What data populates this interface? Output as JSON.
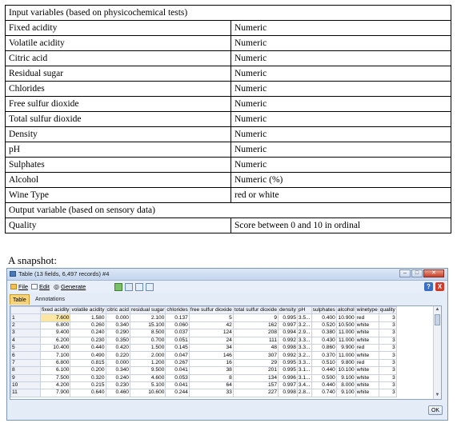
{
  "variables": {
    "input_header": "Input variables (based on physicochemical tests)",
    "inputs": [
      {
        "name": "Fixed acidity",
        "type": "Numeric"
      },
      {
        "name": "Volatile acidity",
        "type": "Numeric"
      },
      {
        "name": "Citric acid",
        "type": "Numeric"
      },
      {
        "name": "Residual sugar",
        "type": "Numeric"
      },
      {
        "name": "Chlorides",
        "type": "Numeric"
      },
      {
        "name": "Free sulfur dioxide",
        "type": "Numeric"
      },
      {
        "name": "Total sulfur dioxide",
        "type": "Numeric"
      },
      {
        "name": "Density",
        "type": "Numeric"
      },
      {
        "name": "pH",
        "type": "Numeric"
      },
      {
        "name": "Sulphates",
        "type": "Numeric"
      },
      {
        "name": "Alcohol",
        "type": "Numeric (%)"
      },
      {
        "name": "Wine Type",
        "type": "red or white"
      }
    ],
    "output_header": "Output variable (based on sensory data)",
    "output": {
      "name": "Quality",
      "type": "Score between 0 and 10 in ordinal"
    }
  },
  "snapshot_label": "A snapshot:",
  "window": {
    "title": "Table (13 fields, 6,497 records) #4",
    "menu": {
      "file": "File",
      "edit": "Edit",
      "generate": "Generate"
    },
    "help": "?",
    "close": "X",
    "tabs": {
      "table": "Table",
      "annotations": "Annotations"
    },
    "ok": "OK",
    "columns": [
      "fixed acidity",
      "volatile acidity",
      "citric acid",
      "residual sugar",
      "chlorides",
      "free sulfur dioxide",
      "total sulfur dioxide",
      "density",
      "pH",
      "sulphates",
      "alcohol",
      "winetype",
      "quality"
    ],
    "rows": [
      [
        "1",
        "7.600",
        "1.580",
        "0.000",
        "2.100",
        "0.137",
        "5",
        "9",
        "0.995",
        "3.5...",
        "0.400",
        "10.900",
        "red",
        "3"
      ],
      [
        "2",
        "6.800",
        "0.260",
        "0.340",
        "15.100",
        "0.060",
        "42",
        "162",
        "0.997",
        "3.2...",
        "0.520",
        "10.500",
        "white",
        "3"
      ],
      [
        "3",
        "9.400",
        "0.240",
        "0.290",
        "8.500",
        "0.037",
        "124",
        "208",
        "0.994",
        "2.9...",
        "0.380",
        "11.000",
        "white",
        "3"
      ],
      [
        "4",
        "6.200",
        "0.230",
        "0.350",
        "0.700",
        "0.051",
        "24",
        "111",
        "0.992",
        "3.3...",
        "0.430",
        "11.000",
        "white",
        "3"
      ],
      [
        "5",
        "10.400",
        "0.440",
        "0.420",
        "1.500",
        "0.145",
        "34",
        "48",
        "0.998",
        "3.3...",
        "0.860",
        "9.900",
        "red",
        "3"
      ],
      [
        "6",
        "7.100",
        "0.490",
        "0.220",
        "2.000",
        "0.047",
        "146",
        "307",
        "0.992",
        "3.2...",
        "0.370",
        "11.000",
        "white",
        "3"
      ],
      [
        "7",
        "6.800",
        "0.815",
        "0.000",
        "1.200",
        "0.267",
        "16",
        "29",
        "0.995",
        "3.3...",
        "0.510",
        "9.800",
        "red",
        "3"
      ],
      [
        "8",
        "6.100",
        "0.200",
        "0.340",
        "9.500",
        "0.041",
        "38",
        "201",
        "0.995",
        "3.1...",
        "0.440",
        "10.100",
        "white",
        "3"
      ],
      [
        "9",
        "7.500",
        "0.320",
        "0.240",
        "4.600",
        "0.053",
        "8",
        "134",
        "0.996",
        "3.1...",
        "0.500",
        "9.100",
        "white",
        "3"
      ],
      [
        "10",
        "4.200",
        "0.215",
        "0.230",
        "5.100",
        "0.041",
        "64",
        "157",
        "0.997",
        "3.4...",
        "0.440",
        "8.000",
        "white",
        "3"
      ],
      [
        "11",
        "7.900",
        "0.640",
        "0.460",
        "10.600",
        "0.244",
        "33",
        "227",
        "0.998",
        "2.8...",
        "0.740",
        "9.100",
        "white",
        "3"
      ]
    ]
  },
  "colors": {
    "active_tab": "#f7d37a",
    "highlight_cell": "#fbe6a2",
    "window_bg": "#e3ecf7"
  }
}
